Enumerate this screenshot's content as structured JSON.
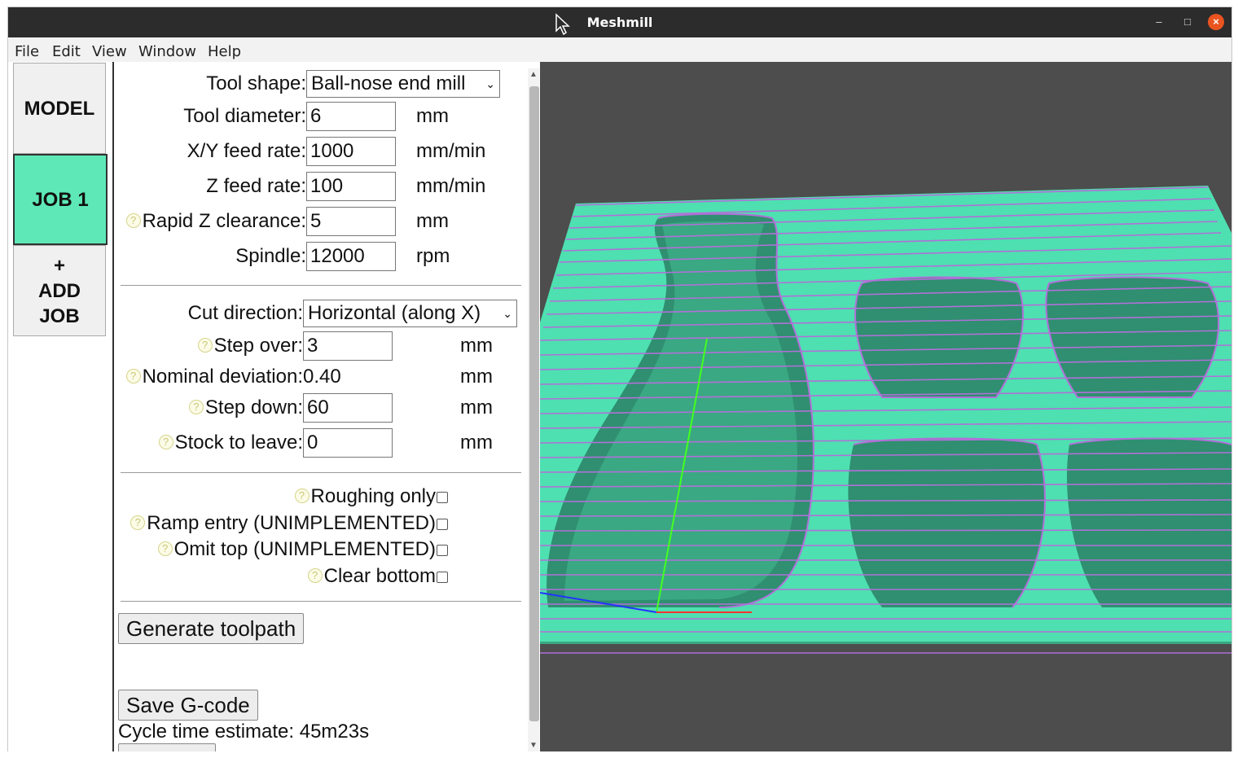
{
  "window": {
    "title": "Meshmill"
  },
  "menu": [
    "File",
    "Edit",
    "View",
    "Window",
    "Help"
  ],
  "tabs": {
    "model": "MODEL",
    "job": "JOB 1",
    "add_plus": "+",
    "add_line1": "ADD",
    "add_line2": "JOB"
  },
  "tool": {
    "shape_label": "Tool shape:",
    "shape_value": "Ball-nose end mill",
    "diameter_label": "Tool diameter:",
    "diameter_value": "6",
    "diameter_unit": "mm",
    "xy_label": "X/Y feed rate:",
    "xy_value": "1000",
    "xy_unit": "mm/min",
    "z_label": "Z feed rate:",
    "z_value": "100",
    "z_unit": "mm/min",
    "rapid_label": "Rapid Z clearance:",
    "rapid_value": "5",
    "rapid_unit": "mm",
    "spindle_label": "Spindle:",
    "spindle_value": "12000",
    "spindle_unit": "rpm"
  },
  "cut": {
    "direction_label": "Cut direction:",
    "direction_value": "Horizontal (along X)",
    "stepover_label": "Step over:",
    "stepover_value": "3",
    "stepover_unit": "mm",
    "deviation_label": "Nominal deviation:",
    "deviation_value": "0.40",
    "deviation_unit": "mm",
    "stepdown_label": "Step down:",
    "stepdown_value": "60",
    "stepdown_unit": "mm",
    "stock_label": "Stock to leave:",
    "stock_value": "0",
    "stock_unit": "mm"
  },
  "options": {
    "roughing": "Roughing only",
    "ramp": "Ramp entry (UNIMPLEMENTED)",
    "omit_top": "Omit top (UNIMPLEMENTED)",
    "clear_bottom": "Clear bottom"
  },
  "actions": {
    "generate": "Generate toolpath",
    "save": "Save G-code",
    "cycle_label": "Cycle time estimate:",
    "cycle_value": "45m23s"
  },
  "colors": {
    "selected_tab": "#5ee8b8",
    "model_fill": "#4ee0b0",
    "toolpath": "#b070d8",
    "viewport_bg": "#4d4d4d"
  }
}
